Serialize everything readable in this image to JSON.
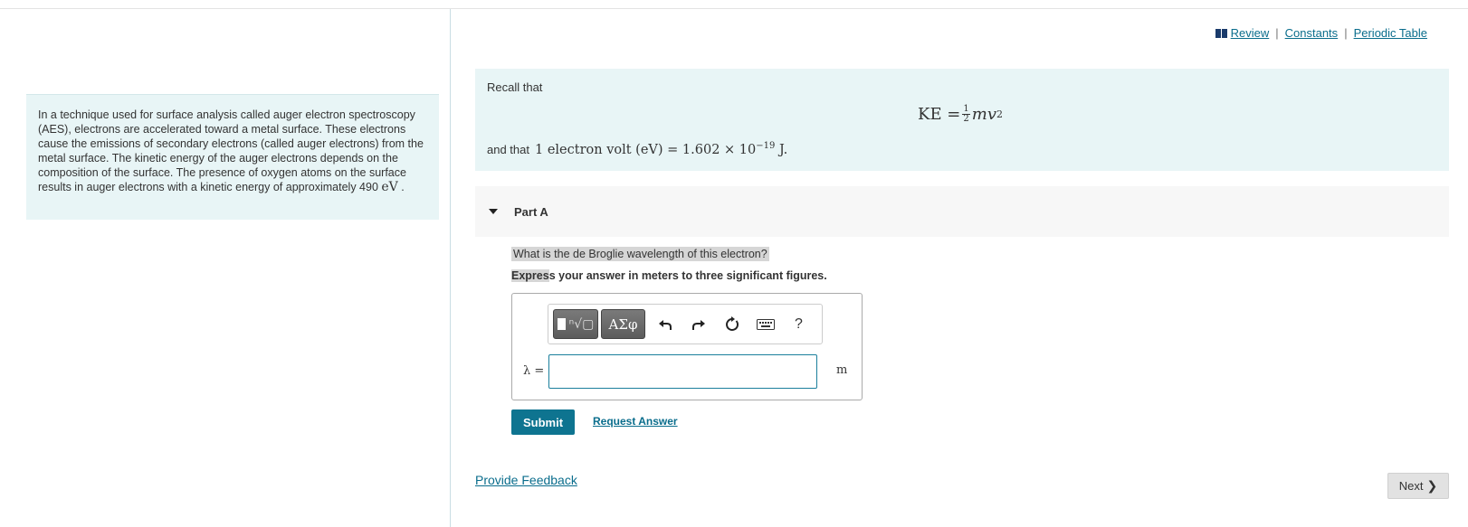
{
  "intro": {
    "text": "In a technique used for surface analysis called auger electron spectroscopy (AES), electrons are accelerated toward a metal surface. These electrons cause the emissions of secondary electrons (called auger electrons) from the metal surface. The kinetic energy of the auger electrons depends on the composition of the surface. The presence of oxygen atoms on the surface results in auger electrons with a kinetic energy of approximately 490",
    "unit": "eV",
    "tail": " ."
  },
  "resources": {
    "review": "Review",
    "constants": "Constants",
    "periodic": "Periodic Table",
    "sep": "|"
  },
  "recall": {
    "line1": "Recall that",
    "ke_lhs": "KE =",
    "frac_num": "1",
    "frac_den": "2",
    "ke_rhs": "mv",
    "ke_exp": "2",
    "line2": "and that",
    "ev_def": "1 electron volt (eV) = 1.602 × 10",
    "ev_exp": "−19",
    "ev_unit": " J."
  },
  "part": {
    "label": "Part A"
  },
  "question": {
    "text": "What is the de Broglie wavelength of this electron?",
    "express_hl": "Expres",
    "express_rest": "s your answer in meters to three significant figures."
  },
  "answer": {
    "var_label": "λ =",
    "value": "",
    "unit": "m",
    "toolbar": {
      "greek": "ΑΣφ",
      "help": "?",
      "icons": [
        "templates-icon",
        "greek-letters-icon",
        "undo-icon",
        "redo-icon",
        "reset-icon",
        "keyboard-icon",
        "help-icon"
      ]
    }
  },
  "actions": {
    "submit": "Submit",
    "request": "Request Answer",
    "feedback": "Provide Feedback",
    "next": "Next"
  },
  "colors": {
    "accent": "#0e7490",
    "link": "#0a6d8c",
    "panel": "#e8f5f6"
  }
}
